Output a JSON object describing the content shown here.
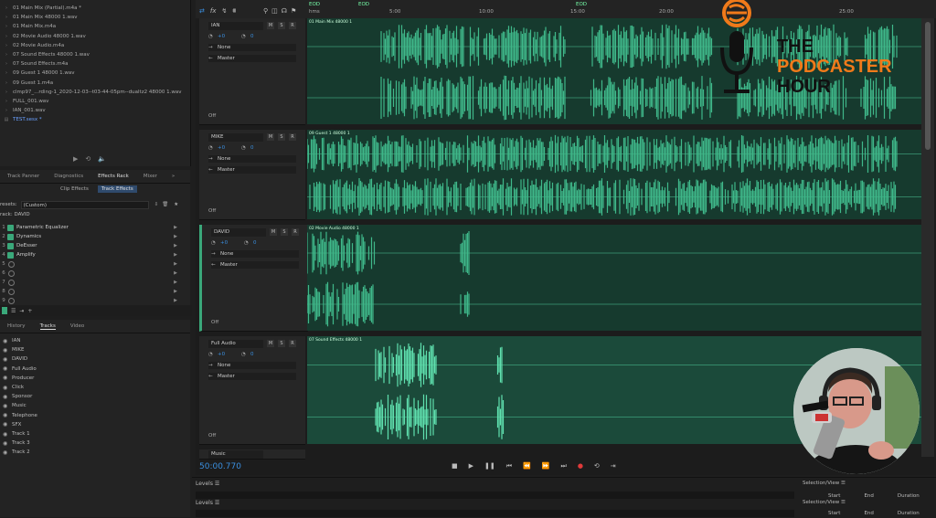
{
  "files": [
    {
      "name": "01 Main Mix (Partial).m4a *",
      "selected": false
    },
    {
      "name": "01 Main Mix 48000 1.wav",
      "selected": false
    },
    {
      "name": "01 Main Mix.m4a",
      "selected": false
    },
    {
      "name": "02 Movie Audio 48000 1.wav",
      "selected": false
    },
    {
      "name": "02 Movie Audio.m4a",
      "selected": false
    },
    {
      "name": "07 Sound Effects 48000 1.wav",
      "selected": false
    },
    {
      "name": "07 Sound Effects.m4a",
      "selected": false
    },
    {
      "name": "09 Guest 1 48000 1.wav",
      "selected": false
    },
    {
      "name": "09 Guest 1.m4a",
      "selected": false
    },
    {
      "name": "clmp97_...rding-1_2020-12-03--t03-44-05pm--dualtz2 48000 1.wav",
      "selected": false
    },
    {
      "name": "FULL_001.wav",
      "selected": false
    },
    {
      "name": "IAN_001.wav",
      "selected": false
    },
    {
      "name": "TEST.sesx *",
      "selected": true
    }
  ],
  "panel_tabs": [
    "Track Panner",
    "Diagnostics",
    "Effects Rack",
    "Mixer"
  ],
  "panel_tab_active": "Effects Rack",
  "fx_subtabs": [
    "Clip Effects",
    "Track Effects"
  ],
  "fx_subtab_active": "Track Effects",
  "presets_label": "resets:",
  "presets_value": "(Custom)",
  "track_label": "rack: DAVID",
  "effects": [
    {
      "n": "1",
      "name": "Parametric Equalizer",
      "on": true
    },
    {
      "n": "2",
      "name": "Dynamics",
      "on": true
    },
    {
      "n": "3",
      "name": "DeEsser",
      "on": true
    },
    {
      "n": "4",
      "name": "Amplify",
      "on": true
    },
    {
      "n": "5",
      "name": "",
      "on": false
    },
    {
      "n": "6",
      "name": "",
      "on": false
    },
    {
      "n": "7",
      "name": "",
      "on": false
    },
    {
      "n": "8",
      "name": "",
      "on": false
    },
    {
      "n": "9",
      "name": "",
      "on": false
    }
  ],
  "bottom_tabs": [
    "History",
    "Tracks",
    "Video"
  ],
  "bottom_tab_active": "Tracks",
  "track_list": [
    "IAN",
    "MIKE",
    "DAVID",
    "Full Audio",
    "Producer",
    "Click",
    "Sponsor",
    "Music",
    "Telephone",
    "SFX",
    "Track 1",
    "Track 3",
    "Track 2"
  ],
  "ruler": {
    "unit": "hms",
    "ticks": [
      "5:00",
      "10:00",
      "15:00",
      "20:00",
      "25:00"
    ],
    "markers": [
      "EOD",
      "EOD",
      "EOD"
    ]
  },
  "tracks": [
    {
      "name": "IAN",
      "clip": "01 Main Mix 48000 1",
      "volume": "+0",
      "pan": "0",
      "input": "None",
      "output": "Master",
      "automation": "Off",
      "color": "#3fb88a"
    },
    {
      "name": "MIKE",
      "clip": "09 Guest 1 48000 1",
      "volume": "+0",
      "pan": "0",
      "input": "None",
      "output": "Master",
      "automation": "Off",
      "color": "#3fb88a"
    },
    {
      "name": "DAVID",
      "clip": "02 Movie Audio 48000 1",
      "volume": "+0",
      "pan": "0",
      "input": "None",
      "output": "Master",
      "automation": "Off",
      "color": "#3fb88a"
    },
    {
      "name": "Full Audio",
      "clip": "07 Sound Effects 48000 1",
      "volume": "+0",
      "pan": "0",
      "input": "None",
      "output": "Master",
      "automation": "Off",
      "color": "#5fe0ae"
    }
  ],
  "next_track": "Music",
  "time_display": "50:00.770",
  "levels_label": "Levels",
  "selection_view": {
    "title": "Selection/View",
    "cols": [
      "Start",
      "End",
      "Duration"
    ]
  },
  "logo": {
    "line1": "THE",
    "line2": "PODCASTER",
    "line3": "HOUR",
    "accent": "#f07a1a"
  },
  "transport_icons": [
    "stop-icon",
    "play-icon",
    "pause-icon",
    "goto-start-icon",
    "rewind-icon",
    "fast-forward-icon",
    "goto-end-icon",
    "record-icon",
    "loop-icon",
    "skip-icon"
  ]
}
